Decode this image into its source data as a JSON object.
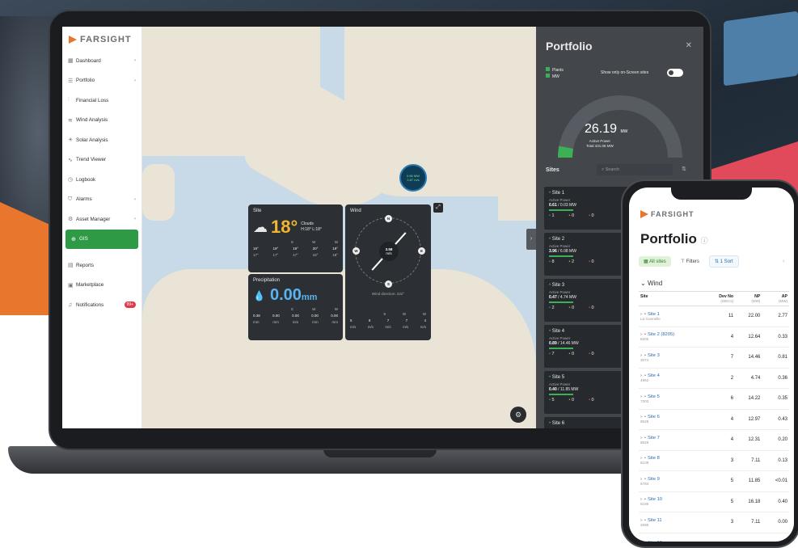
{
  "sidebar": {
    "logo": "FARSIGHT",
    "items": [
      {
        "label": "Dashboard",
        "icon": "grid-icon",
        "chevron": true
      },
      {
        "label": "Portfolio",
        "icon": "list-icon",
        "chevron": true
      },
      {
        "label": "Financial Loss",
        "icon": "chart-icon",
        "chevron": false
      },
      {
        "label": "Wind Analysis",
        "icon": "wind-icon",
        "chevron": false
      },
      {
        "label": "Solar Analysis",
        "icon": "sun-icon",
        "chevron": false
      },
      {
        "label": "Trend Viewer",
        "icon": "trend-icon",
        "chevron": false
      },
      {
        "label": "Logbook",
        "icon": "clock-icon",
        "chevron": false
      },
      {
        "label": "Alarms",
        "icon": "shield-icon",
        "chevron": true
      },
      {
        "label": "Asset Manager",
        "icon": "asset-icon",
        "chevron": true
      },
      {
        "label": "GIS",
        "icon": "globe-icon",
        "chevron": false,
        "active": true
      },
      {
        "label": "Reports",
        "icon": "report-icon",
        "chevron": false
      },
      {
        "label": "Marketplace",
        "icon": "store-icon",
        "chevron": false
      },
      {
        "label": "Notifications",
        "icon": "bell-icon",
        "chevron": false,
        "badge": "99+"
      }
    ]
  },
  "map": {
    "marker": {
      "line1": "0.66 MW",
      "line2": "2.87 m/s"
    }
  },
  "weather": {
    "site_title": "Site",
    "temperature": "18°",
    "condition": "Clouds",
    "hi_lo": "H:18° L:18°",
    "site_forecast": {
      "dirs": [
        "",
        "",
        "S",
        "W",
        "W"
      ],
      "temps": [
        "19°",
        "19°",
        "19°",
        "20°",
        "19°"
      ],
      "lows": [
        "17°",
        "17°",
        "17°",
        "18°",
        "18°"
      ]
    },
    "wind_title": "Wind",
    "wind_speed": "3.58",
    "wind_unit": "m/s",
    "wind_direction": "Wind direction: 222°",
    "compass": [
      "N",
      "E",
      "S",
      "W"
    ],
    "wind_forecast": {
      "dirs": [
        "",
        "",
        "S",
        "W",
        "W"
      ],
      "vals": [
        "5",
        "6",
        "7",
        "7",
        "4"
      ],
      "units": [
        "m/s",
        "m/s",
        "m/s",
        "m/s",
        "m/s"
      ]
    },
    "precip_title": "Precipitation",
    "precip_value": "0.00",
    "precip_unit": "mm",
    "precip_forecast": {
      "dirs": [
        "",
        "",
        "S",
        "W",
        "W"
      ],
      "vals": [
        "0.38",
        "0.00",
        "0.00",
        "0.00",
        "0.00"
      ],
      "units": [
        "mm",
        "mm",
        "mm",
        "mm",
        "mm"
      ]
    }
  },
  "portfolio": {
    "title": "Portfolio",
    "legend": [
      "Plants",
      "MW"
    ],
    "toggle_label": "Show only on-Screen sites",
    "active_power": "26.19",
    "active_power_unit": "MW",
    "active_power_label": "Active Power",
    "total_label": "Total 431.06 MW",
    "gauge_fraction": 0.06,
    "sites_header": "Sites",
    "search_placeholder": "Search",
    "sites": [
      {
        "name": "Site 1",
        "ap_label": "Active Power",
        "power": "0.61",
        "capacity": "/ 0.03 MW",
        "g": "1",
        "o": "0",
        "r": "0"
      },
      {
        "name": "Site 2",
        "ap_label": "Active Power",
        "power": "3.96",
        "capacity": "/ 6.08 MW",
        "g": "8",
        "o": "2",
        "r": "0"
      },
      {
        "name": "Site 3",
        "ap_label": "Active Power",
        "power": "0.47",
        "capacity": "/ 4.74 MW",
        "g": "2",
        "o": "0",
        "r": "0"
      },
      {
        "name": "Site 4",
        "ap_label": "Active Power",
        "power": "0.89",
        "capacity": "/ 14.46 MW",
        "g": "7",
        "o": "0",
        "r": "0"
      },
      {
        "name": "Site 5",
        "ap_label": "Active Power",
        "power": "0.40",
        "capacity": "/ 11.85 MW",
        "g": "5",
        "o": "0",
        "r": "0"
      },
      {
        "name": "Site 6",
        "ap_label": "",
        "power": "",
        "capacity": "",
        "g": "",
        "o": "",
        "r": ""
      }
    ]
  },
  "phone": {
    "logo": "FARSIGHT",
    "title": "Portfolio",
    "chip_all": "All sites",
    "chip_filters": "Filters",
    "chip_sort": "1 Sort",
    "group": "Wind",
    "headers": [
      {
        "label": "Site",
        "sub": ""
      },
      {
        "label": "Dev No",
        "sub": "(WECs)"
      },
      {
        "label": "NP",
        "sub": "(MW)"
      },
      {
        "label": "AP",
        "sub": "(MW)"
      }
    ],
    "rows": [
      {
        "name": "Site 1",
        "sub": "La Guenelle",
        "dev": "11",
        "np": "22.00",
        "ap": "2.77",
        "status": "red"
      },
      {
        "name": "Site 2 (8205)",
        "sub": "8205",
        "dev": "4",
        "np": "12.64",
        "ap": "0.33",
        "status": "red"
      },
      {
        "name": "Site 3",
        "sub": "3074",
        "dev": "7",
        "np": "14.46",
        "ap": "0.81",
        "status": "green"
      },
      {
        "name": "Site 4",
        "sub": "4962",
        "dev": "2",
        "np": "4.74",
        "ap": "0.36",
        "status": "green"
      },
      {
        "name": "Site 5",
        "sub": "7303",
        "dev": "6",
        "np": "14.22",
        "ap": "0.35",
        "status": "green"
      },
      {
        "name": "Site 6",
        "sub": "8528",
        "dev": "4",
        "np": "12.97",
        "ap": "0.43",
        "status": "green"
      },
      {
        "name": "Site 7",
        "sub": "8529",
        "dev": "4",
        "np": "12.31",
        "ap": "0.20",
        "status": "green"
      },
      {
        "name": "Site 8",
        "sub": "8109",
        "dev": "3",
        "np": "7.11",
        "ap": "0.13",
        "status": "green"
      },
      {
        "name": "Site 9",
        "sub": "6784",
        "dev": "5",
        "np": "11.85",
        "ap": "<0.01",
        "status": "green"
      },
      {
        "name": "Site 10",
        "sub": "8189",
        "dev": "5",
        "np": "16.18",
        "ap": "0.40",
        "status": "green"
      },
      {
        "name": "Site 11",
        "sub": "2695",
        "dev": "3",
        "np": "7.11",
        "ap": "0.00",
        "status": "green"
      },
      {
        "name": "Site 12",
        "sub": "",
        "dev": "",
        "np": "",
        "ap": "",
        "status": "green"
      }
    ]
  }
}
